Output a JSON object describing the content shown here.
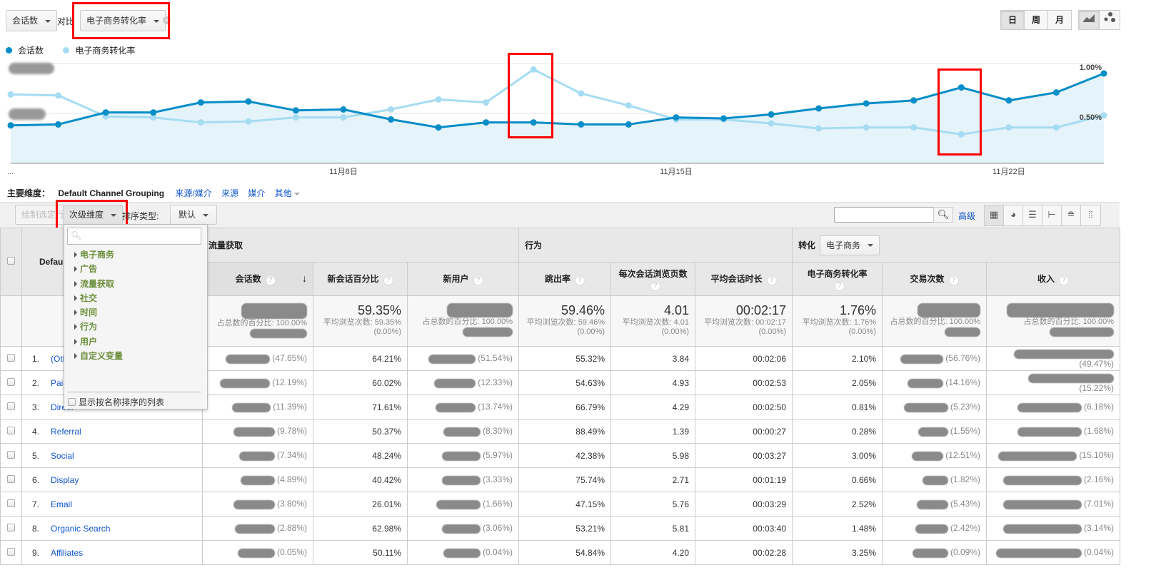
{
  "controls": {
    "metric1": "会话数",
    "vs_label": "对比",
    "metric2": "电子商务转化率",
    "granularity": [
      {
        "label": "日",
        "active": true
      },
      {
        "label": "周",
        "active": false
      },
      {
        "label": "月",
        "active": false
      }
    ],
    "chart_types": [
      "line-chart-icon",
      "motion-chart-icon"
    ]
  },
  "legend": [
    {
      "label": "会话数",
      "color": "#058dc7"
    },
    {
      "label": "电子商务转化率",
      "color": "#a6dcf2"
    }
  ],
  "chart_data": {
    "type": "line",
    "x": [
      "11月1日",
      "11月2日",
      "11月3日",
      "11月4日",
      "11月5日",
      "11月6日",
      "11月7日",
      "11月8日",
      "11月9日",
      "11月10日",
      "11月11日",
      "11月12日",
      "11月13日",
      "11月14日",
      "11月15日",
      "11月16日",
      "11月17日",
      "11月18日",
      "11月19日",
      "11月20日",
      "11月21日",
      "11月22日",
      "11月23日",
      "11月24日"
    ],
    "x_ticks": [
      "11月8日",
      "11月15日",
      "11月22日"
    ],
    "x_start_label": "...",
    "series": [
      {
        "name": "会话数",
        "axis": "left",
        "note": "left axis labels obscured; values relative to axis max",
        "values": [
          0.38,
          0.39,
          0.51,
          0.51,
          0.61,
          0.62,
          0.53,
          0.54,
          0.44,
          0.36,
          0.41,
          0.41,
          0.39,
          0.39,
          0.46,
          0.45,
          0.49,
          0.55,
          0.6,
          0.63,
          0.76,
          0.63,
          0.71,
          0.9
        ],
        "color": "#058dc7"
      },
      {
        "name": "电子商务转化率",
        "axis": "right",
        "values": [
          0.69,
          0.68,
          0.47,
          0.46,
          0.41,
          0.42,
          0.46,
          0.46,
          0.54,
          0.64,
          0.61,
          0.94,
          0.7,
          0.58,
          0.44,
          0.44,
          0.4,
          0.35,
          0.36,
          0.36,
          0.29,
          0.36,
          0.36,
          0.48
        ],
        "color": "#a6dcf2"
      }
    ],
    "right_axis_ticks": [
      "1.00%",
      "0.50%"
    ],
    "ylim": [
      0,
      1.0
    ],
    "grid": true
  },
  "dimension_bar": {
    "label": "主要维度：",
    "active": "Default Channel Grouping",
    "links": [
      "来源/媒介",
      "来源",
      "媒介",
      "其他"
    ]
  },
  "toolbar": {
    "plot_rows": "绘制选定行",
    "secondary_dim": "次级维度",
    "sort_label": "排序类型:",
    "sort_value": "默认",
    "search_value": "",
    "advanced": "高级"
  },
  "dropdown": {
    "search_value": "",
    "items": [
      "电子商务",
      "广告",
      "流量获取",
      "社交",
      "时间",
      "行为",
      "用户",
      "自定义变量"
    ],
    "checkbox_label": "显示按名称排序的列表"
  },
  "table": {
    "dim_header": "Default Channel Grouping",
    "groups": {
      "acquisition": "流量获取",
      "behavior": "行为",
      "conversion": "转化",
      "conversion_select": "电子商务"
    },
    "headers": [
      "会话数",
      "新会话百分比",
      "新用户",
      "跳出率",
      "每次会话浏览页数",
      "平均会话时长",
      "电子商务转化率",
      "交易次数",
      "收入"
    ],
    "totals": {
      "sessions_sub": "占总数的百分比: 100.00%",
      "new_pct": "59.35%",
      "new_pct_sub": "平均浏览次数: 59.35% (0.00%)",
      "new_users_sub": "占总数的百分比: 100.00%",
      "bounce": "59.46%",
      "bounce_sub": "平均浏览次数: 59.46% (0.00%)",
      "pages": "4.01",
      "pages_sub": "平均浏览次数: 4.01 (0.00%)",
      "duration": "00:02:17",
      "duration_sub": "平均浏览次数: 00:02:17 (0.00%)",
      "conv": "1.76%",
      "conv_sub": "平均浏览次数: 1.76% (0.00%)",
      "trans_sub": "占总数的百分比: 100.00%",
      "rev_sub": "占总数的百分比: 100.00%"
    },
    "rows": [
      {
        "n": "1.",
        "name": "(Other)",
        "s": "(47.65%)",
        "np": "64.21%",
        "nu": "(51.54%)",
        "b": "55.32%",
        "p": "3.84",
        "d": "00:02:06",
        "c": "2.10%",
        "t": "(56.76%)",
        "r": "(49.47%)"
      },
      {
        "n": "2.",
        "name": "Paid Search",
        "s": "(12.19%)",
        "np": "60.02%",
        "nu": "(12.33%)",
        "b": "54.63%",
        "p": "4.93",
        "d": "00:02:53",
        "c": "2.05%",
        "t": "(14.16%)",
        "r": "(15.22%)"
      },
      {
        "n": "3.",
        "name": "Direct",
        "s": "(11.39%)",
        "np": "71.61%",
        "nu": "(13.74%)",
        "b": "66.79%",
        "p": "4.29",
        "d": "00:02:50",
        "c": "0.81%",
        "t": "(5.23%)",
        "r": "(6.18%)"
      },
      {
        "n": "4.",
        "name": "Referral",
        "s": "(9.78%)",
        "np": "50.37%",
        "nu": "(8.30%)",
        "b": "88.49%",
        "p": "1.39",
        "d": "00:00:27",
        "c": "0.28%",
        "t": "(1.55%)",
        "r": "(1.68%)"
      },
      {
        "n": "5.",
        "name": "Social",
        "s": "(7.34%)",
        "np": "48.24%",
        "nu": "(5.97%)",
        "b": "42.38%",
        "p": "5.98",
        "d": "00:03:27",
        "c": "3.00%",
        "t": "(12.51%)",
        "r": "(15.10%)"
      },
      {
        "n": "6.",
        "name": "Display",
        "s": "(4.89%)",
        "np": "40.42%",
        "nu": "(3.33%)",
        "b": "75.74%",
        "p": "2.71",
        "d": "00:01:19",
        "c": "0.66%",
        "t": "(1.82%)",
        "r": "(2.16%)"
      },
      {
        "n": "7.",
        "name": "Email",
        "s": "(3.80%)",
        "np": "26.01%",
        "nu": "(1.66%)",
        "b": "47.15%",
        "p": "5.76",
        "d": "00:03:29",
        "c": "2.52%",
        "t": "(5.43%)",
        "r": "(7.01%)"
      },
      {
        "n": "8.",
        "name": "Organic Search",
        "s": "(2.88%)",
        "np": "62.98%",
        "nu": "(3.06%)",
        "b": "53.21%",
        "p": "5.81",
        "d": "00:03:40",
        "c": "1.48%",
        "t": "(2.42%)",
        "r": "(3.14%)"
      },
      {
        "n": "9.",
        "name": "Affiliates",
        "s": "(0.05%)",
        "np": "50.11%",
        "nu": "(0.04%)",
        "b": "54.84%",
        "p": "4.20",
        "d": "00:02:28",
        "c": "3.25%",
        "t": "(0.09%)",
        "r": "(0.04%)"
      }
    ]
  }
}
